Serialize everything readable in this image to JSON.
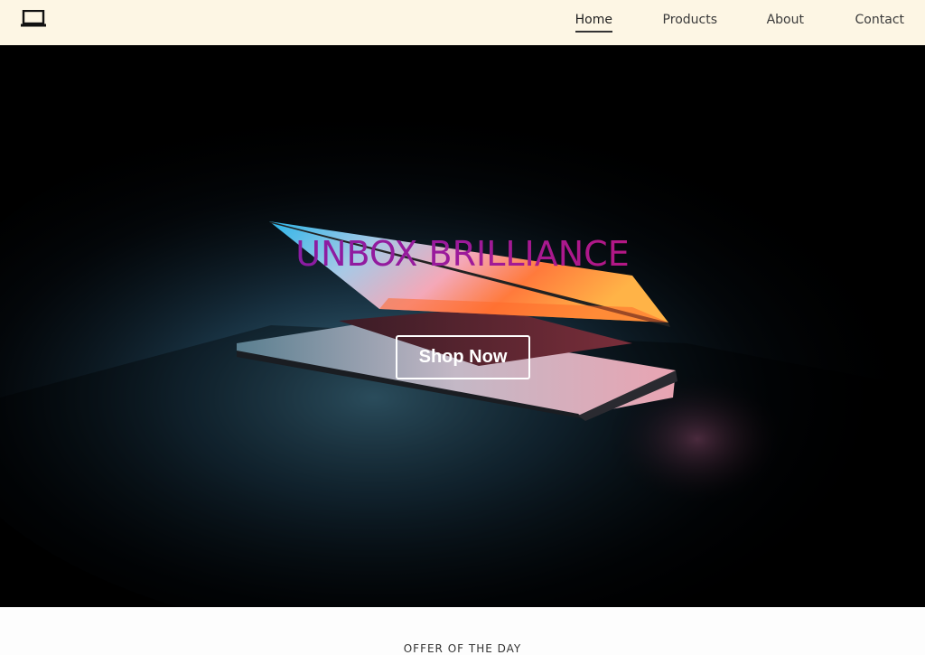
{
  "nav": {
    "logo_icon": "laptop-icon",
    "links": [
      {
        "label": "Home",
        "active": true
      },
      {
        "label": "Products",
        "active": false
      },
      {
        "label": "About",
        "active": false
      },
      {
        "label": "Contact",
        "active": false
      }
    ]
  },
  "hero": {
    "title": "UNBOX BRILLIANCE",
    "button_label": "Shop Now",
    "background_image": "laptop-half-open-glowing-photo",
    "title_gradient": [
      "#6a1fb3",
      "#9c1a9a",
      "#e0145e"
    ]
  },
  "offer": {
    "title": "OFFER OF THE DAY"
  },
  "colors": {
    "navbar_bg": "#fdf6e4",
    "hero_bg": "#000000",
    "button_border": "#ffffff"
  }
}
